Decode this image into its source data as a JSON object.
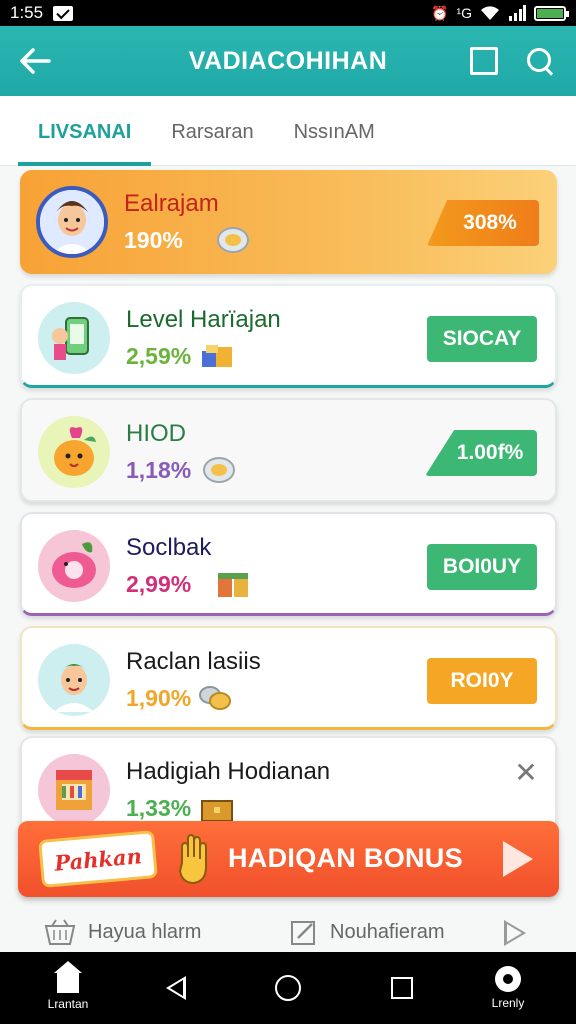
{
  "status_bar": {
    "time": "1:55",
    "network": "¹G"
  },
  "header": {
    "title": "VADIACOHIHAN",
    "back_icon": "arrow-left-icon",
    "action_icons": [
      "square-icon",
      "search-icon"
    ]
  },
  "tabs": [
    {
      "label": "LIVSANAI",
      "active": true
    },
    {
      "label": "Rarsaran",
      "active": false
    },
    {
      "label": "NssınAM",
      "active": false
    }
  ],
  "cards": [
    {
      "name": "Ealrajam",
      "percent": "190%",
      "action": "308%",
      "name_color": "#c2241d",
      "pct_color": "#ffffff",
      "action_color": "#f57c1f"
    },
    {
      "name": "Level Harïajan",
      "percent": "2,59%",
      "action": "SIOCAY",
      "name_color": "#1b6a2e",
      "pct_color": "#6bb33c",
      "action_color": "#3db774"
    },
    {
      "name": "HIOD",
      "percent": "1,18%",
      "action": "1.00f%",
      "name_color": "#2a7d45",
      "pct_color": "#8a5ab7",
      "action_color": "#3db774"
    },
    {
      "name": "Soclbak",
      "percent": "2,99%",
      "action": "BOI0UY",
      "name_color": "#1e1c5c",
      "pct_color": "#d0307a",
      "action_color": "#3db774"
    },
    {
      "name": "Raclan lasiis",
      "percent": "1,90%",
      "action": "ROI0Y",
      "name_color": "#1a1a1a",
      "pct_color": "#f1a62a",
      "action_color": "#f5a624"
    },
    {
      "name": "Hadigiah Hodianan",
      "percent": "1,33%",
      "action": "",
      "name_color": "#1a1a1a",
      "pct_color": "#4caf50",
      "action_color": ""
    }
  ],
  "bonus": {
    "badge": "Pahkan",
    "label": "HADIQAN BONUS",
    "hand_icon": "hand-icon",
    "play_icon": "play-icon"
  },
  "footer_links": [
    {
      "label": "Hayua hlarm",
      "icon": "basket-icon"
    },
    {
      "label": "Nouhafieram",
      "icon": "edit-icon"
    }
  ],
  "nav_bar": {
    "home_label": "Lrantan",
    "right_label": "Lrenly"
  },
  "colors": {
    "primary": "#1ea9a6",
    "bonus": "#f1502b",
    "card_highlight": "#f7a235"
  }
}
